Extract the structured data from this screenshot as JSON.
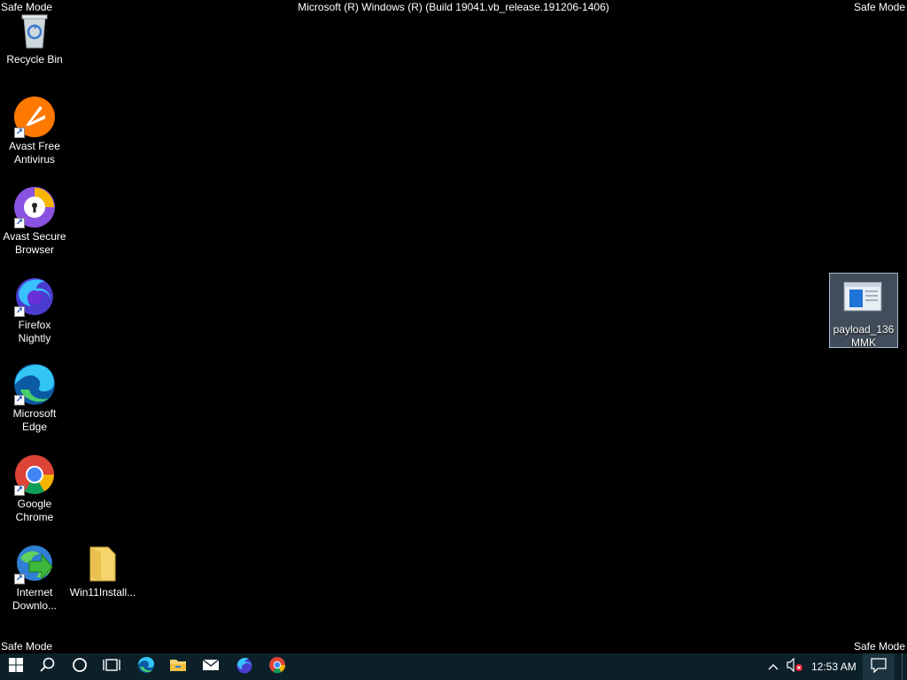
{
  "safe_mode": {
    "top_left": "Safe Mode",
    "top_right": "Safe Mode",
    "bottom_left": "Safe Mode",
    "bottom_right": "Safe Mode"
  },
  "build_text": "Microsoft (R) Windows (R) (Build 19041.vb_release.191206-1406)",
  "desktop_icons": {
    "recycle_bin": "Recycle Bin",
    "avast_antivirus": "Avast Free Antivirus",
    "avast_browser": "Avast Secure Browser",
    "firefox_nightly": "Firefox Nightly",
    "edge": "Microsoft Edge",
    "chrome": "Google Chrome",
    "idm": "Internet Downlo...",
    "win11_folder": "Win11Install...",
    "payload": "payload_136 MMK"
  },
  "taskbar": {
    "clock": "12:53 AM",
    "icons": [
      "start-icon",
      "search-icon",
      "cortana-icon",
      "task-view-icon",
      "edge-icon",
      "file-explorer-icon",
      "mail-icon",
      "firefox-icon",
      "chrome-icon"
    ]
  }
}
